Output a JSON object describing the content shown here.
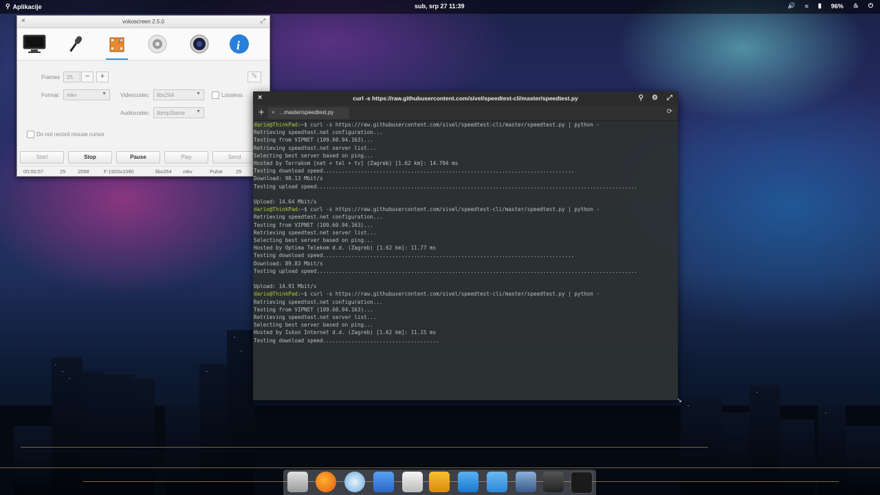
{
  "top_panel": {
    "apps_label": "Aplikacije",
    "datetime": "sub, srp 27     11:39",
    "battery": "96%"
  },
  "voko": {
    "title": "vokoscreen 2.5.0",
    "tabs": [
      "screen-icon",
      "microphone-icon",
      "video-settings-icon",
      "gear-icon",
      "webcam-icon",
      "info-icon"
    ],
    "frames_label": "Frames",
    "frames_value": "25",
    "format_label": "Format",
    "format_value": "mkv",
    "videocodec_label": "Videocodec",
    "videocodec_value": "libx264",
    "lossless_label": "Lossless",
    "audiocodec_label": "Audiocodec",
    "audiocodec_value": "libmp3lame",
    "mouse_label": "Do not record mouse cursor",
    "buttons": {
      "start": "Start",
      "stop": "Stop",
      "pause": "Pause",
      "play": "Play",
      "send": "Send"
    },
    "status": {
      "time": "00:00:57",
      "fps": "25",
      "frames": "2558",
      "resolution": "F:1920x1080",
      "codec": "libx264",
      "format": "mkv",
      "audio": "Pulse",
      "audio_fps": "25"
    }
  },
  "terminal": {
    "title": "curl -s https://raw.githubusercontent.com/sivel/speedtest-cli/master/speedtest.py",
    "tab_label": "...master/speedtest.py",
    "prompt": "dario@ThinkPad",
    "command": ":~$ curl -s https://raw.githubusercontent.com/sivel/speedtest-cli/master/speedtest.py | python -",
    "runs": [
      {
        "lines": [
          "Retrieving speedtest.net configuration...",
          "Testing from VIPNET (109.60.94.163)...",
          "Retrieving speedtest.net server list...",
          "Selecting best server based on ping...",
          "Hosted by Terrakom [net + tel + tv] (Zagreb) [1.62 km]: 14.794 ms",
          "Testing download speed................................................................................",
          "Download: 90.13 Mbit/s",
          "Testing upload speed......................................................................................................",
          "",
          "Upload: 14.64 Mbit/s"
        ]
      },
      {
        "lines": [
          "Retrieving speedtest.net configuration...",
          "Testing from VIPNET (109.60.94.163)...",
          "Retrieving speedtest.net server list...",
          "Selecting best server based on ping...",
          "Hosted by Optima Telekom d.d. (Zagreb) [1.62 km]: 11.77 ms",
          "Testing download speed................................................................................",
          "Download: 89.83 Mbit/s",
          "Testing upload speed......................................................................................................",
          "",
          "Upload: 14.91 Mbit/s"
        ]
      },
      {
        "lines": [
          "Retrieving speedtest.net configuration...",
          "Testing from VIPNET (109.60.94.163)...",
          "Retrieving speedtest.net server list...",
          "Selecting best server based on ping...",
          "Hosted by Iskon Internet d.d. (Zagreb) [1.62 km]: 11.15 ms",
          "Testing download speed....................................."
        ]
      }
    ]
  },
  "dock": {
    "items": [
      "files-icon",
      "firefox-icon",
      "mail-icon",
      "document-icon",
      "calculator-icon",
      "video-player-icon",
      "download-icon",
      "toggle-settings-icon",
      "screenshot-icon",
      "screen-recorder-icon",
      "terminal-icon"
    ]
  }
}
